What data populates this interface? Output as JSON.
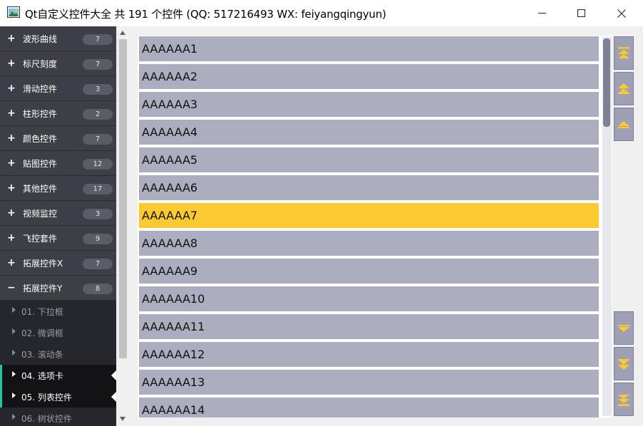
{
  "window": {
    "title": "Qt自定义控件大全 共 191 个控件 (QQ: 517216493 WX: feiyangqingyun)",
    "minimize_glyph": "—",
    "maximize_glyph": "☐",
    "close_glyph": "✕"
  },
  "sidebar": {
    "parents": [
      {
        "icon": "+",
        "label": "波形曲线",
        "count": "7"
      },
      {
        "icon": "+",
        "label": "标尺刻度",
        "count": "7"
      },
      {
        "icon": "+",
        "label": "滑动控件",
        "count": "3"
      },
      {
        "icon": "+",
        "label": "柱形控件",
        "count": "2"
      },
      {
        "icon": "+",
        "label": "颜色控件",
        "count": "7"
      },
      {
        "icon": "+",
        "label": "贴图控件",
        "count": "12"
      },
      {
        "icon": "+",
        "label": "其他控件",
        "count": "17"
      },
      {
        "icon": "+",
        "label": "视频监控",
        "count": "3"
      },
      {
        "icon": "+",
        "label": "飞控套件",
        "count": "9"
      },
      {
        "icon": "+",
        "label": "拓展控件X",
        "count": "7"
      },
      {
        "icon": "−",
        "label": "拓展控件Y",
        "count": "8"
      }
    ],
    "children": [
      {
        "label": "01. 下拉框",
        "active": false
      },
      {
        "label": "02. 微调框",
        "active": false
      },
      {
        "label": "03. 滚动条",
        "active": false
      },
      {
        "label": "04. 选项卡",
        "active": true
      },
      {
        "label": "05. 列表控件",
        "active": true
      },
      {
        "label": "06. 树状控件",
        "active": false
      }
    ]
  },
  "list": {
    "items": [
      "AAAAAA1",
      "AAAAAA2",
      "AAAAAA3",
      "AAAAAA4",
      "AAAAAA5",
      "AAAAAA6",
      "AAAAAA7",
      "AAAAAA8",
      "AAAAAA9",
      "AAAAAA10",
      "AAAAAA11",
      "AAAAAA12",
      "AAAAAA13",
      "AAAAAA14"
    ],
    "selected": "AAAAAA7"
  },
  "nav_buttons": [
    "move-top-icon",
    "page-up-icon",
    "move-up-icon",
    "move-down-icon",
    "page-down-icon",
    "move-bottom-icon"
  ],
  "colors": {
    "sidebar_bg": "#2e2f35",
    "item_bg": "#adadc0",
    "selected_bg": "#fdc931",
    "accent": "#23c6a0",
    "nav_icon": "#fdc931"
  }
}
